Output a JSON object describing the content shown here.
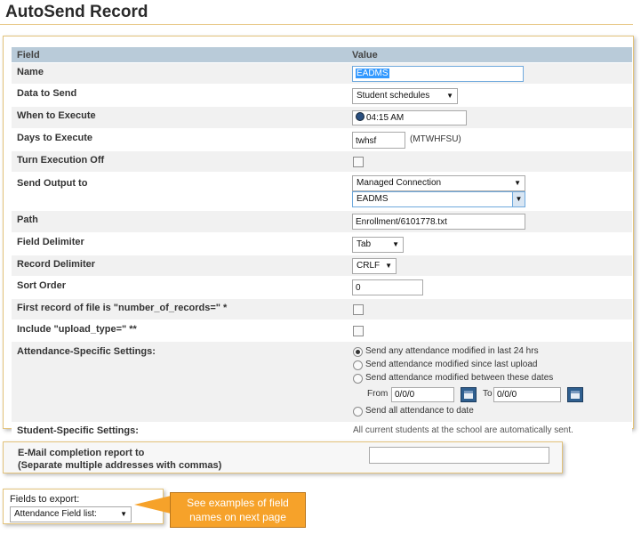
{
  "page_title": "AutoSend Record",
  "table": {
    "header_field": "Field",
    "header_value": "Value",
    "name_label": "Name",
    "name_value": "EADMS",
    "data_to_send_label": "Data to Send",
    "data_to_send_value": "Student schedules",
    "when_label": "When to Execute",
    "when_value": "04:15 AM",
    "days_label": "Days to Execute",
    "days_value": "twhsf",
    "days_hint": "(MTWHFSU)",
    "exec_off_label": "Turn Execution Off",
    "send_output_label": "Send Output to",
    "send_output_value": "Managed Connection",
    "send_output_sub_value": "EADMS",
    "path_label": "Path",
    "path_value": "Enrollment/6101778.txt",
    "field_delim_label": "Field Delimiter",
    "field_delim_value": "Tab",
    "record_delim_label": "Record Delimiter",
    "record_delim_value": "CRLF",
    "sort_order_label": "Sort Order",
    "sort_order_value": "0",
    "first_record_label": "First record of file is \"number_of_records=\" *",
    "upload_type_label": "Include \"upload_type=\" **",
    "attendance_label": "Attendance-Specific Settings:",
    "attendance_options": [
      "Send any attendance modified in last 24 hrs",
      "Send attendance modified since last upload",
      "Send attendance modified between these dates",
      "Send all attendance to date"
    ],
    "from_label": "From",
    "from_value": "0/0/0",
    "to_label": "To",
    "to_value": "0/0/0",
    "student_label": "Student-Specific Settings:",
    "student_value": "All current students at the school are automatically sent."
  },
  "email": {
    "label_line1": "E-Mail completion report to",
    "label_line2": "(Separate multiple addresses with commas)",
    "value": ""
  },
  "fields_export": {
    "label": "Fields to export:",
    "select_value": "Attendance Field list:"
  },
  "callout": {
    "line1": "See examples of field",
    "line2": "names on next page"
  },
  "colors": {
    "header_bg": "#b9cbd9",
    "accent_border": "#e2c27a",
    "callout_bg": "#f6a22a",
    "calendar_btn": "#2f5f8f"
  },
  "icons": [
    "clock-icon",
    "calendar-icon",
    "dropdown-arrow-icon",
    "checkbox",
    "radio-button"
  ]
}
